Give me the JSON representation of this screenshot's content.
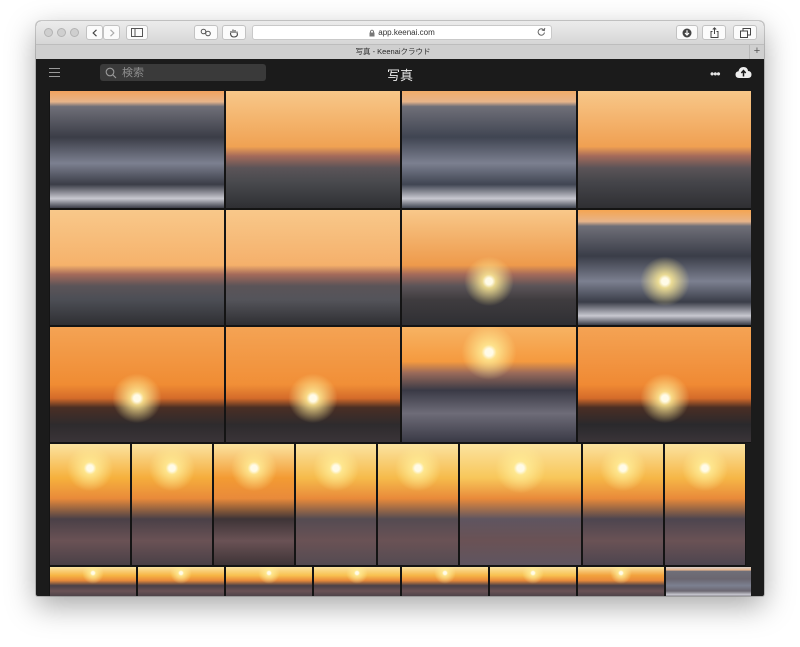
{
  "browser": {
    "url": "app.keenai.com",
    "tab_title": "写真 - Keenaiクラウド",
    "new_tab": "+"
  },
  "app": {
    "search_placeholder": "検索",
    "title": "写真",
    "more": "•••"
  },
  "icons": {
    "menu": "hamburger-menu-icon",
    "search": "search-icon",
    "more": "more-dots-icon",
    "upload": "cloud-upload-icon"
  },
  "colors": {
    "app_background": "#1b1b1b",
    "search_background": "#3a3a3a",
    "titlebar": "#dcdcdc"
  },
  "gallery": {
    "rows": [
      {
        "photos": [
          {
            "type": "sea-dawn",
            "sky": "#f3a05a",
            "sea": "#3b3d47",
            "sun": false
          },
          {
            "type": "cloud-band",
            "sky": "#f0a253",
            "sea": "#494a4e",
            "sun": false
          },
          {
            "type": "sea-dawn",
            "sky": "#f3ac66",
            "sea": "#404552",
            "sun": false
          },
          {
            "type": "cloud-band",
            "sky": "#f0a052",
            "sea": "#45454a",
            "sun": false
          }
        ]
      },
      {
        "photos": [
          {
            "type": "cloud-band",
            "sky": "#f6b26b",
            "sea": "#4c4e55",
            "sun": false
          },
          {
            "type": "cloud-band",
            "sky": "#f5b06b",
            "sea": "#54545a",
            "sun": false
          },
          {
            "type": "cloud-band",
            "sky": "#ee9a4b",
            "sea": "#3f3c3f",
            "sun": true
          },
          {
            "type": "sea-dawn",
            "sky": "#f5a551",
            "sea": "#3a3d48",
            "sun": true
          }
        ]
      },
      {
        "photos": [
          {
            "type": "sunrise",
            "sky": "#f08c33",
            "sea": "#2e2b2d",
            "sun": true
          },
          {
            "type": "sunrise",
            "sky": "#f18f37",
            "sea": "#2e2b2d",
            "sun": true
          },
          {
            "type": "sunrise-sea",
            "sky": "#f59a3f",
            "sea": "#3a3a46",
            "sun": true
          },
          {
            "type": "sunrise",
            "sky": "#f08a34",
            "sea": "#2a292c",
            "sun": true
          }
        ]
      },
      {
        "photos": [
          {
            "type": "bright",
            "sky": "#f6b13d",
            "sea": "#4a4047",
            "sun": true
          },
          {
            "type": "bright",
            "sky": "#f5ad3c",
            "sea": "#4a4047",
            "sun": true
          },
          {
            "type": "bright",
            "sky": "#f39b33",
            "sea": "#3e3437",
            "sun": true
          },
          {
            "type": "bright",
            "sky": "#f6bb4b",
            "sea": "#544b52",
            "sun": true
          },
          {
            "type": "bright",
            "sky": "#f6bb4b",
            "sea": "#544b52",
            "sun": true
          },
          {
            "type": "bright",
            "sky": "#f8c75a",
            "sea": "#5f5560",
            "sun": true
          },
          {
            "type": "bright",
            "sky": "#f6b747",
            "sea": "#4d454f",
            "sun": true
          },
          {
            "type": "bright",
            "sky": "#f6b747",
            "sea": "#4d454f",
            "sun": true
          }
        ]
      },
      {
        "photos": [
          {
            "type": "bright",
            "sky": "#f7b544",
            "sea": "#4a4047",
            "sun": true
          },
          {
            "type": "bright",
            "sky": "#f7b544",
            "sea": "#4a4047",
            "sun": true
          },
          {
            "type": "bright",
            "sky": "#f8c150",
            "sea": "#4a4047",
            "sun": true
          },
          {
            "type": "bright",
            "sky": "#f8c150",
            "sea": "#4a4047",
            "sun": true
          },
          {
            "type": "bright",
            "sky": "#f6b547",
            "sea": "#4a4047",
            "sun": true
          },
          {
            "type": "bright",
            "sky": "#f8c150",
            "sea": "#4a4047",
            "sun": true
          },
          {
            "type": "bright",
            "sky": "#f2a23c",
            "sea": "#4a4047",
            "sun": true
          },
          {
            "type": "sea-dawn",
            "sky": "#d9d2cc",
            "sea": "#6a6670",
            "sun": false
          }
        ]
      }
    ]
  }
}
